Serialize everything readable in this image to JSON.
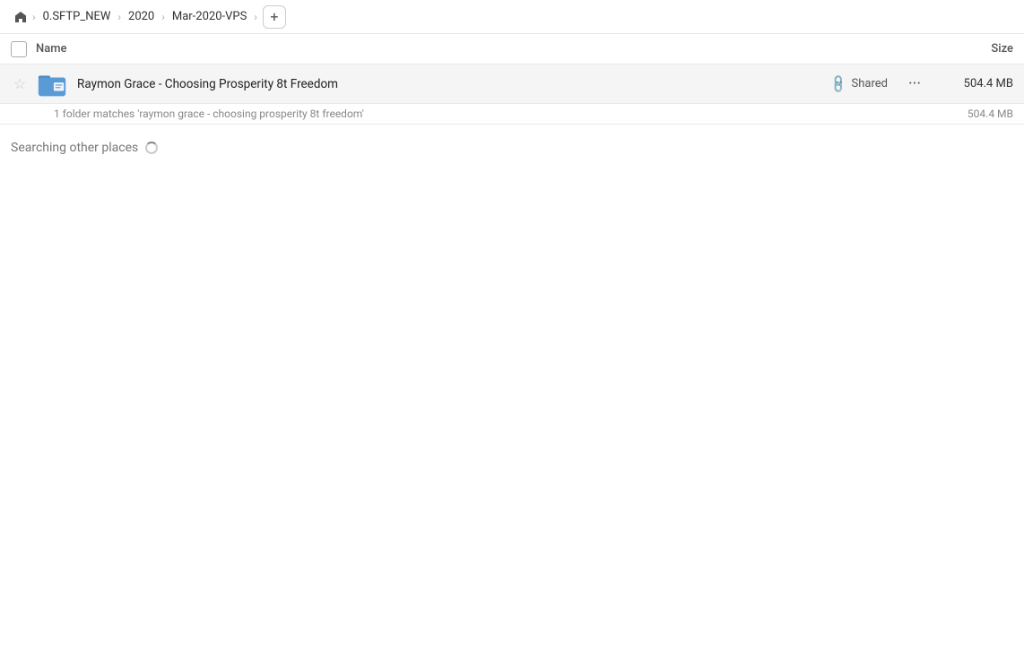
{
  "breadcrumb": {
    "home_icon": "⌂",
    "items": [
      "0.SFTP_NEW",
      "2020",
      "Mar-2020-VPS"
    ],
    "add_icon": "+"
  },
  "columns": {
    "name_label": "Name",
    "size_label": "Size"
  },
  "result": {
    "folder_name": "Raymon Grace - Choosing Prosperity 8t Freedom",
    "shared_label": "Shared",
    "size": "504.4 MB",
    "more_icon": "···"
  },
  "match_info": {
    "text": "1 folder matches 'raymon grace - choosing prosperity 8t freedom'",
    "size": "504.4 MB"
  },
  "searching": {
    "label": "Searching other places"
  }
}
